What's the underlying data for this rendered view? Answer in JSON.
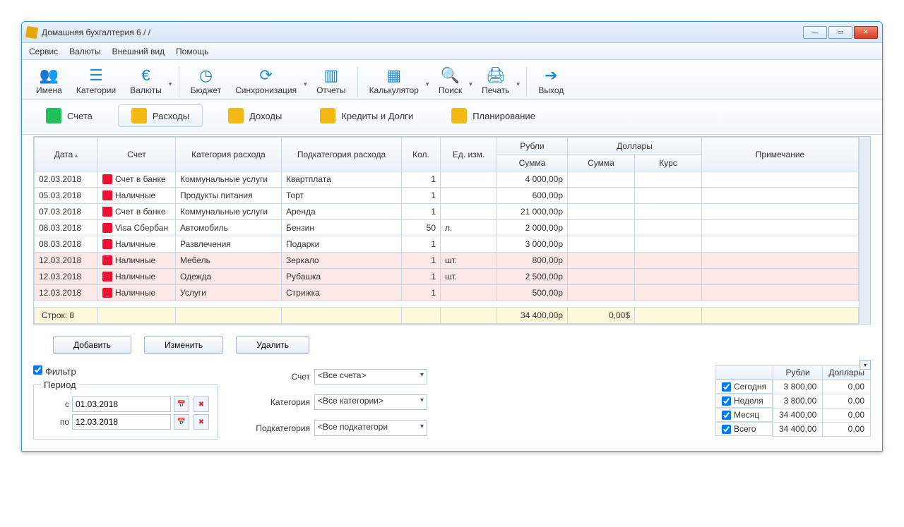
{
  "window": {
    "title": "Домашняя бухгалтерия 6 /              /"
  },
  "menu": [
    "Сервис",
    "Валюты",
    "Внешний вид",
    "Помощь"
  ],
  "toolbar": {
    "names": "Имена",
    "categories": "Категории",
    "currencies": "Валюты",
    "budget": "Бюджет",
    "sync": "Синхронизация",
    "reports": "Отчеты",
    "calculator": "Калькулятор",
    "search": "Поиск",
    "print": "Печать",
    "exit": "Выход"
  },
  "tabs": {
    "accounts": "Счета",
    "expenses": "Расходы",
    "income": "Доходы",
    "credits": "Кредиты и Долги",
    "planning": "Планирование"
  },
  "grid": {
    "headers": {
      "date": "Дата",
      "account": "Счет",
      "category": "Категория расхода",
      "subcategory": "Подкатегория расхода",
      "qty": "Кол.",
      "unit": "Ед. изм.",
      "rubles": "Рубли",
      "dollars": "Доллары",
      "sum": "Сумма",
      "rate": "Курс",
      "note": "Примечание"
    },
    "rows": [
      {
        "date": "02.03.2018",
        "account": "Счет в банке",
        "icon": "bank",
        "category": "Коммунальные услуги",
        "subcategory": "Квартплата",
        "qty": "1",
        "unit": "",
        "rub": "4 000,00р",
        "hl": false
      },
      {
        "date": "05.03.2018",
        "account": "Наличные",
        "icon": "cash",
        "category": "Продукты питания",
        "subcategory": "Торт",
        "qty": "1",
        "unit": "",
        "rub": "600,00р",
        "hl": false
      },
      {
        "date": "07.03.2018",
        "account": "Счет в банке",
        "icon": "bank",
        "category": "Коммунальные услуги",
        "subcategory": "Аренда",
        "qty": "1",
        "unit": "",
        "rub": "21 000,00р",
        "hl": false
      },
      {
        "date": "08.03.2018",
        "account": "Visa Сбербан",
        "icon": "visa",
        "category": "Автомобиль",
        "subcategory": "Бензин",
        "qty": "50",
        "unit": "л.",
        "rub": "2 000,00р",
        "hl": false
      },
      {
        "date": "08.03.2018",
        "account": "Наличные",
        "icon": "cash",
        "category": "Развлечения",
        "subcategory": "Подарки",
        "qty": "1",
        "unit": "",
        "rub": "3 000,00р",
        "hl": false
      },
      {
        "date": "12.03.2018",
        "account": "Наличные",
        "icon": "cash",
        "category": "Мебель",
        "subcategory": "Зеркало",
        "qty": "1",
        "unit": "шт.",
        "rub": "800,00р",
        "hl": true
      },
      {
        "date": "12.03.2018",
        "account": "Наличные",
        "icon": "cash",
        "category": "Одежда",
        "subcategory": "Рубашка",
        "qty": "1",
        "unit": "шт.",
        "rub": "2 500,00р",
        "hl": true
      },
      {
        "date": "12.03.2018",
        "account": "Наличные",
        "icon": "cash",
        "category": "Услуги",
        "subcategory": "Стрижка",
        "qty": "1",
        "unit": "",
        "rub": "500,00р",
        "hl": true
      }
    ],
    "totals": {
      "rowcount": "Строк: 8",
      "rub": "34 400,00р",
      "usd": "0,00$"
    }
  },
  "buttons": {
    "add": "Добавить",
    "edit": "Изменить",
    "delete": "Удалить"
  },
  "filter": {
    "checkbox_label": "Фильтр",
    "period_label": "Период",
    "from_label": "с",
    "from_value": "01.03.2018",
    "to_label": "по",
    "to_value": "12.03.2018",
    "account_label": "Счет",
    "account_value": "<Все счета>",
    "category_label": "Категория",
    "category_value": "<Все категории>",
    "subcategory_label": "Подкатегория",
    "subcategory_value": "<Все подкатегори"
  },
  "summary": {
    "headers": {
      "rub": "Рубли",
      "usd": "Доллары"
    },
    "rows": [
      {
        "label": "Сегодня",
        "rub": "3 800,00",
        "usd": "0,00"
      },
      {
        "label": "Неделя",
        "rub": "3 800,00",
        "usd": "0,00"
      },
      {
        "label": "Месяц",
        "rub": "34 400,00",
        "usd": "0,00"
      },
      {
        "label": "Всего",
        "rub": "34 400,00",
        "usd": "0,00"
      }
    ]
  }
}
